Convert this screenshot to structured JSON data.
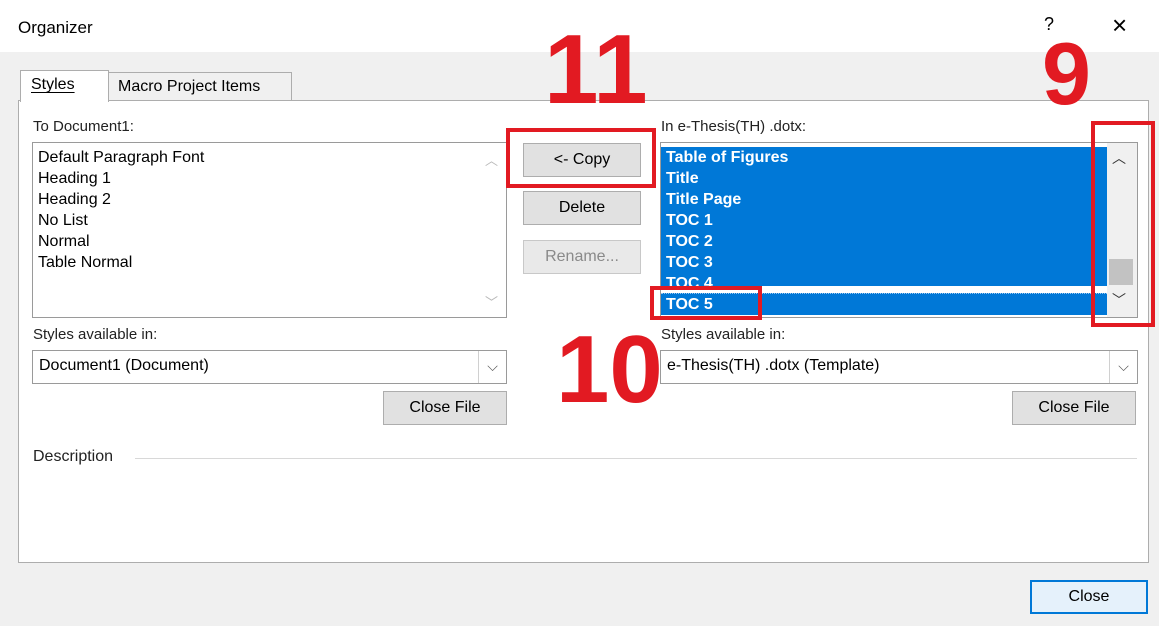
{
  "window": {
    "title": "Organizer",
    "help_glyph": "?",
    "close_glyph": "×"
  },
  "tabs": [
    {
      "label": "Styles",
      "selected": true
    },
    {
      "label": "Macro Project Items",
      "selected": false
    }
  ],
  "left": {
    "list_label": "To Document1:",
    "items": [
      "Default Paragraph Font",
      "Heading 1",
      "Heading 2",
      "No List",
      "Normal",
      "Table Normal"
    ],
    "styles_available_label": "Styles available in:",
    "styles_available_value": "Document1 (Document)",
    "close_file_label": "Close File"
  },
  "middle": {
    "copy_label": "<- Copy",
    "delete_label": "Delete",
    "rename_label": "Rename..."
  },
  "right": {
    "list_label": "In e-Thesis(TH) .dotx:",
    "items": [
      "Table of Figures",
      "Title",
      "Title Page",
      "TOC 1",
      "TOC 2",
      "TOC 3",
      "TOC 4",
      "TOC 5"
    ],
    "styles_available_label": "Styles available in:",
    "styles_available_value": "e-Thesis(TH) .dotx (Template)",
    "close_file_label": "Close File"
  },
  "description_label": "Description",
  "close_label": "Close",
  "annotations": [
    "11",
    "9",
    "10"
  ],
  "colors": {
    "selection": "#0078d7",
    "annotation_red": "#e21a22",
    "dialog_bg": "#f0f0f0"
  }
}
